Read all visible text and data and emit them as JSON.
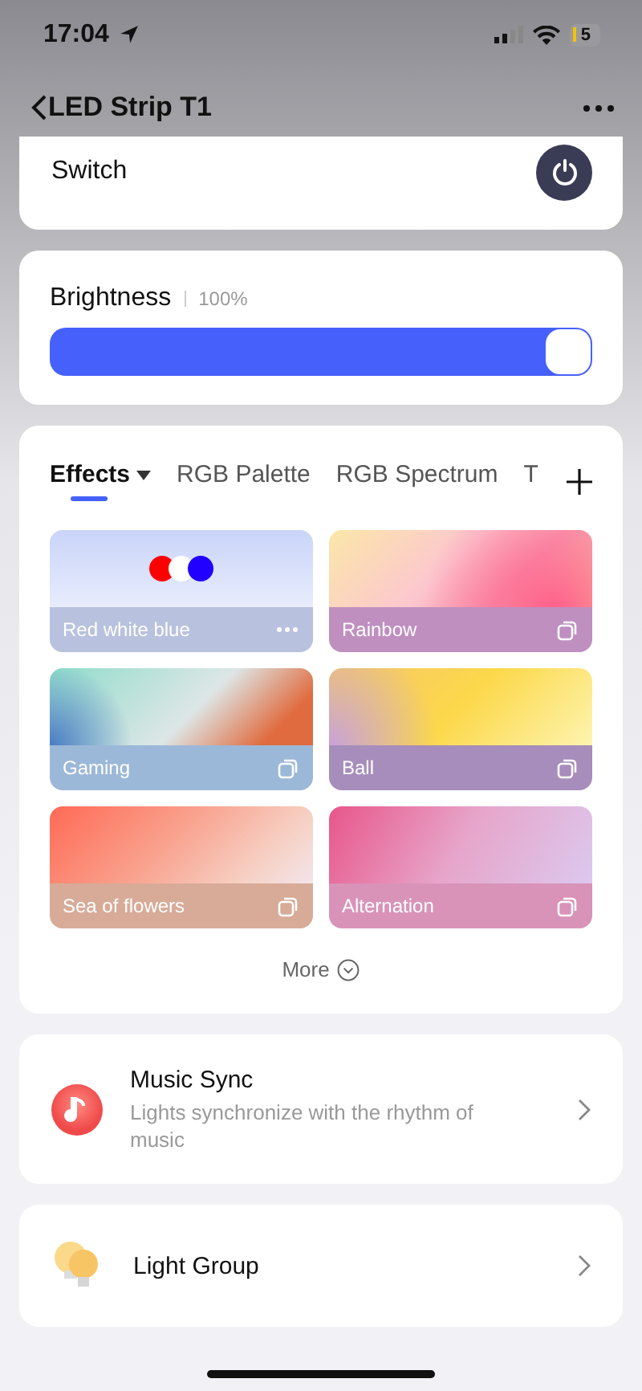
{
  "status_bar": {
    "time": "17:04",
    "battery": "5"
  },
  "nav": {
    "title": "LED Strip T1"
  },
  "switch": {
    "label": "Switch",
    "on": true
  },
  "brightness": {
    "label": "Brightness",
    "reading": "100%",
    "level": 1.0
  },
  "tabs": [
    {
      "label": "Effects",
      "selected": true,
      "dropdown": true
    },
    {
      "label": "RGB Palette",
      "selected": false,
      "dropdown": false
    },
    {
      "label": "RGB Spectrum",
      "selected": false,
      "dropdown": false
    },
    {
      "label": "T",
      "selected": false,
      "dropdown": false
    }
  ],
  "effects": [
    {
      "name": "Red white blue",
      "kind": "custom",
      "color": "#b8c1dd",
      "dots": [
        {
          "color": "#ff0000"
        },
        {
          "color": "#ffffff"
        },
        {
          "color": "#2200ff"
        }
      ]
    },
    {
      "name": "Rainbow",
      "kind": "preset",
      "color": "#bf8fc0"
    },
    {
      "name": "Gaming",
      "kind": "preset",
      "color": "#9cb8d8"
    },
    {
      "name": "Ball",
      "kind": "preset",
      "color": "#a68dbb"
    },
    {
      "name": "Sea of flowers",
      "kind": "preset",
      "color": "#d7ab98"
    },
    {
      "name": "Alternation",
      "kind": "preset",
      "color": "#d993b9"
    }
  ],
  "more": "More",
  "features": [
    {
      "title": "Music Sync",
      "subtitle": "Lights synchronize with the rhythm of music",
      "kind": "music"
    },
    {
      "title": "Light Group",
      "kind": "group"
    }
  ]
}
